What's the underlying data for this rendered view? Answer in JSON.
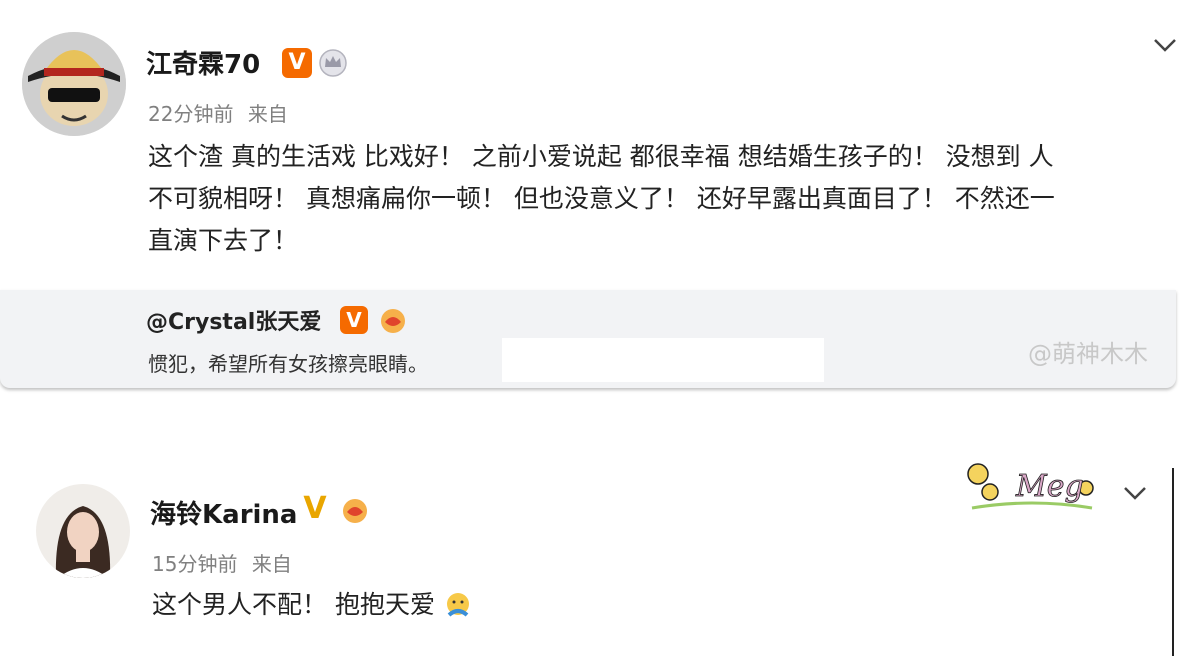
{
  "post1": {
    "username": "江奇霖70",
    "verified_badge": "V",
    "meta_time": "22分钟前",
    "meta_source": "来自",
    "text_lines": [
      "这个渣 真的生活戏 比戏好！ 之前小爱说起 都很幸福 想结婚生孩子的！ 没想到 人",
      "不可貌相呀！ 真想痛扁你一顿！ 但也没意义了！ 还好早露出真面目了！ 不然还一",
      "直演下去了！"
    ],
    "repost": {
      "author": "@Crystal张天爱",
      "badge": "V",
      "text": "惯犯，希望所有女孩擦亮眼睛。"
    },
    "watermark": "@萌神木木"
  },
  "post2": {
    "username": "海铃Karina",
    "verified_badge": "V",
    "meta_time": "15分钟前",
    "meta_source": "来自",
    "text": "这个男人不配！ 抱抱天爱",
    "sticker_text": "Meg"
  },
  "colors": {
    "orange_badge": "#f56a00",
    "gold_badge": "#e9a600",
    "repost_bg": "#f2f3f5"
  },
  "icons": [
    "chevron-down-icon",
    "crown-icon",
    "hand-badge-icon",
    "hug-emoji-icon"
  ]
}
